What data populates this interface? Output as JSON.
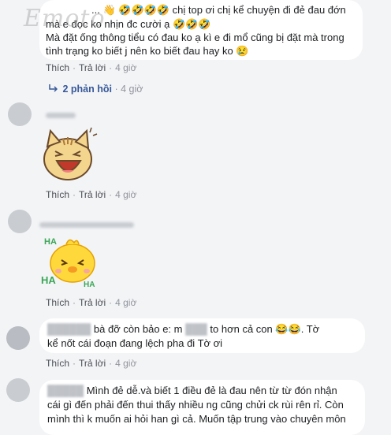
{
  "watermark": "Emoto",
  "comments": [
    {
      "text_line1": "chị top ơi chị kể chuyện đi đẻ đau đớn",
      "text_line2": "mà e đọc ko nhịn đc cười ạ",
      "text_line3": "Mà đặt ống thông tiểu có đau ko ạ kì e đi mổ cũng bị đặt mà trong",
      "text_line4": "tình trạng ko biết j nên ko biết đau hay ko",
      "prefix": "...",
      "emoji_wave": "👋",
      "emoji_laugh": "🤣🤣🤣🤣",
      "emoji_laugh2": "🤣🤣🤣",
      "emoji_sad": "😢",
      "like": "Thích",
      "reply": "Trả lời",
      "time": "4 giờ",
      "replies_label": "2 phản hồi",
      "replies_time": "4 giờ"
    },
    {
      "sticker": "cat-laughing",
      "like": "Thích",
      "reply": "Trả lời",
      "time": "4 giờ"
    },
    {
      "sticker": "chick-ha-ha",
      "sticker_text_1": "HA",
      "sticker_text_2": "HA",
      "sticker_text_3": "HA",
      "like": "Thích",
      "reply": "Trả lời",
      "time": "4 giờ"
    },
    {
      "text_a": "bà đỡ còn bảo e: m",
      "text_b": "to hơn cả con",
      "emoji": "😂😂",
      "text_c": ". Tờ",
      "text_line2": "kể nốt cái đoạn đang lệch pha đi Tờ ơi",
      "like": "Thích",
      "reply": "Trả lời",
      "time": "4 giờ"
    },
    {
      "text_line1": "Mình đẻ dễ.và biết 1 điều đẻ là đau nên từ từ đón nhận",
      "text_line2": "cái gì đến phải đến thui thấy nhiều ng cũng chửi ck rùi rên rỉ. Còn",
      "text_line3": "mình thì k muốn ai hỏi han gì cả. Muốn tập trung vào chuyên môn"
    }
  ]
}
